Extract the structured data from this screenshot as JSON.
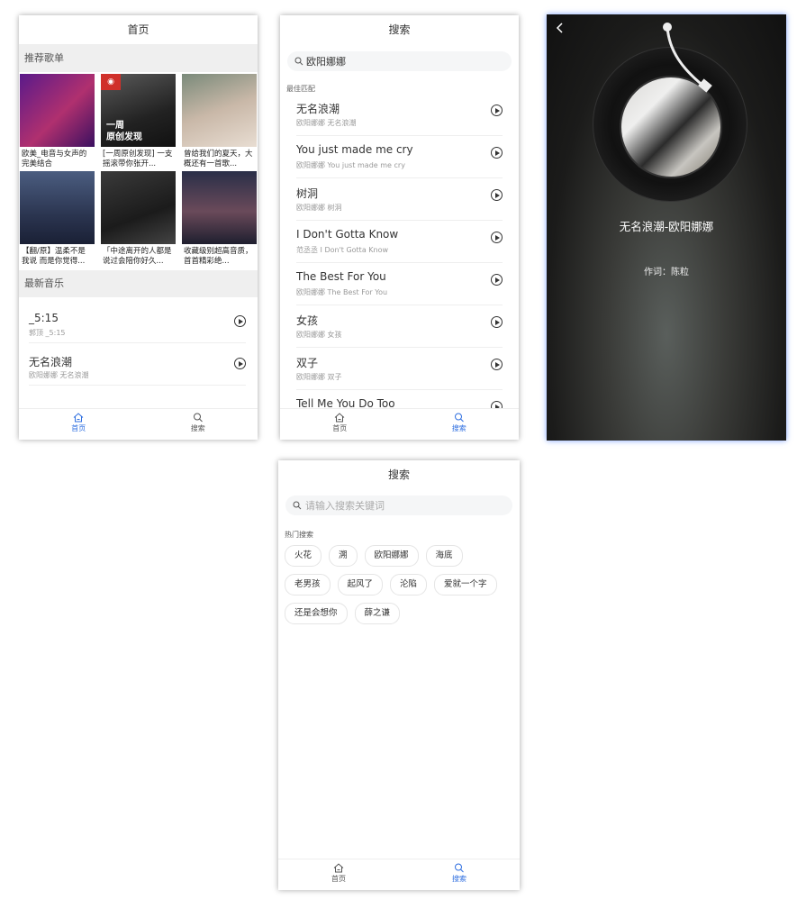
{
  "home": {
    "title": "首页",
    "recommend_label": "推荐歌单",
    "playlists": [
      {
        "title": "欧美_电音与女声的完美结合",
        "cover": "c1",
        "badge": "",
        "overlay": ""
      },
      {
        "title": "[一周原创发现] 一支摇滚带你张开...",
        "cover": "c2",
        "badge": "网易云",
        "overlay": "一周\n原创发现"
      },
      {
        "title": "曾给我们的夏天，大概还有一首歌...",
        "cover": "c3",
        "badge": "",
        "overlay": ""
      },
      {
        "title": "【翻/原】温柔不是我说 而是你觉得...",
        "cover": "c4",
        "badge": "",
        "overlay": ""
      },
      {
        "title": "「中途离开的人都是说过会陪你好久...",
        "cover": "c5",
        "badge": "",
        "overlay": ""
      },
      {
        "title": "收藏级别超高音质，首首精彩绝...",
        "cover": "c6",
        "badge": "",
        "overlay": ""
      }
    ],
    "newmusic_label": "最新音乐",
    "songs": [
      {
        "name": "_5:15",
        "sub": "郭顶 _5:15"
      },
      {
        "name": "无名浪潮",
        "sub": "欧阳娜娜 无名浪潮"
      }
    ]
  },
  "tabs": {
    "home": "首页",
    "search": "搜索"
  },
  "search_results": {
    "title": "搜索",
    "query": "欧阳娜娜",
    "best_match_label": "最佳匹配",
    "results": [
      {
        "name": "无名浪潮",
        "sub": "欧阳娜娜 无名浪潮"
      },
      {
        "name": "You just made me cry",
        "sub": "欧阳娜娜 You just made me cry"
      },
      {
        "name": "树洞",
        "sub": "欧阳娜娜 树洞"
      },
      {
        "name": "I Don't Gotta Know",
        "sub": "范丞丞 I Don't Gotta Know"
      },
      {
        "name": "The Best For You",
        "sub": "欧阳娜娜 The Best For You"
      },
      {
        "name": "女孩",
        "sub": "欧阳娜娜 女孩"
      },
      {
        "name": "双子",
        "sub": "欧阳娜娜 双子"
      },
      {
        "name": "Tell Me You Do Too",
        "sub": ""
      }
    ]
  },
  "player": {
    "title": "无名浪潮-欧阳娜娜",
    "lyric": "作词：陈粒"
  },
  "search_empty": {
    "title": "搜索",
    "placeholder": "请输入搜索关键词",
    "hot_label": "热门搜索",
    "hot_tags": [
      "火花",
      "溯",
      "欧阳娜娜",
      "海底",
      "老男孩",
      "起风了",
      "沦陷",
      "爱就一个字",
      "还是会想你",
      "薛之谦"
    ]
  },
  "colors": {
    "accent": "#2f6fe0",
    "section_bg": "#efefef"
  }
}
